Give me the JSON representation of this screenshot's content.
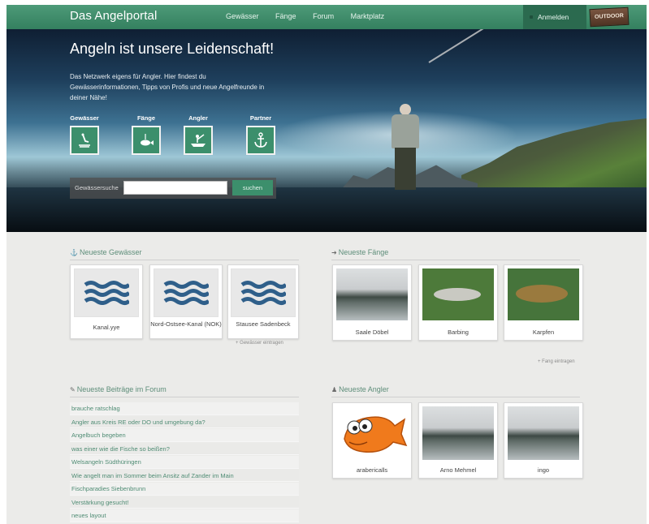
{
  "header": {
    "logo": "Das Angelportal",
    "nav": [
      "Gewässer",
      "Fänge",
      "Forum",
      "Marktplatz"
    ],
    "login": "Anmelden",
    "badge": "OUTDOOR"
  },
  "hero": {
    "title": "Angeln ist unsere Leidenschaft!",
    "text": "Das Netzwerk eigens für Angler. Hier findest du Gewässerinformationen, Tipps von Profis und neue Angelfreunde in deiner Nähe!",
    "categories": [
      {
        "label": "Gewässer",
        "icon": "fishing-spot-icon"
      },
      {
        "label": "Fänge",
        "icon": "fish-icon"
      },
      {
        "label": "Angler",
        "icon": "angler-boat-icon"
      },
      {
        "label": "Partner",
        "icon": "anchor-icon"
      }
    ],
    "search": {
      "label": "Gewässersuche",
      "placeholder": "",
      "button": "suchen"
    }
  },
  "waters": {
    "title": "Neueste Gewässer",
    "items": [
      "Kanal.yye",
      "Nord-Ostsee-Kanal (NOK)",
      "Stausee Sadenbeck"
    ],
    "add_link": "+ Gewässer eintragen"
  },
  "catches": {
    "title": "Neueste Fänge",
    "items": [
      "Saale Döbel",
      "Barbing",
      "Karpfen"
    ],
    "add_link": "+ Fang eintragen"
  },
  "forum": {
    "title": "Neueste Beiträge im Forum",
    "posts": [
      "brauche ratschlag",
      "Angler aus Kreis RE oder DO und umgebung da?",
      "Angelbuch begeben",
      "was einer wie die Fische so beißen?",
      "Welsangeln Südthüringen",
      "Wie angelt man im Sommer beim Ansitz auf Zander im Main",
      "Fischparadies Siebenbrunn",
      "Verstärkung gesucht!",
      "neues layout"
    ]
  },
  "anglers": {
    "title": "Neueste Angler",
    "items": [
      "arabericalls",
      "Arno Mehmel",
      "ingo"
    ]
  }
}
